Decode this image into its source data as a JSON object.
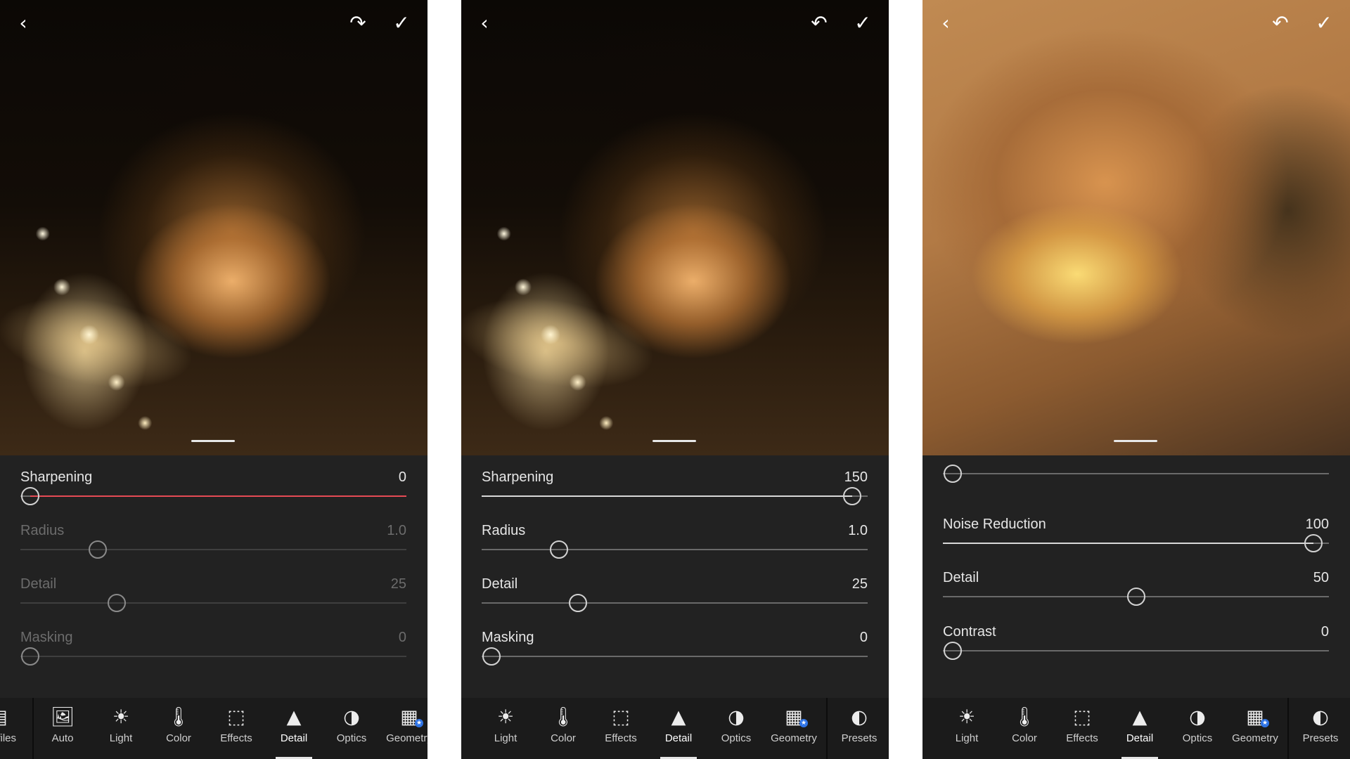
{
  "colors": {
    "accent_red": "#e64b55",
    "badge_blue": "#2f74e6",
    "panel_bg": "#232323"
  },
  "panels": [
    {
      "top_icons": [
        "back-icon",
        "redo-icon",
        "check-icon"
      ],
      "sliders": [
        {
          "label": "Sharpening",
          "value": "0",
          "level": 0,
          "active": true,
          "red": true
        },
        {
          "label": "Radius",
          "value": "1.0",
          "level": 0.2,
          "active": false
        },
        {
          "label": "Detail",
          "value": "25",
          "level": 0.25,
          "active": false
        },
        {
          "label": "Masking",
          "value": "0",
          "level": 0,
          "active": false
        }
      ],
      "tools": [
        {
          "label": "Profiles",
          "icon": "profiles-icon"
        },
        {
          "label": "Auto",
          "icon": "auto-icon"
        },
        {
          "label": "Light",
          "icon": "light-icon"
        },
        {
          "label": "Color",
          "icon": "color-icon"
        },
        {
          "label": "Effects",
          "icon": "effects-icon"
        },
        {
          "label": "Detail",
          "icon": "detail-icon",
          "active": true
        },
        {
          "label": "Optics",
          "icon": "optics-icon"
        },
        {
          "label": "Geometry",
          "icon": "geometry-icon"
        }
      ]
    },
    {
      "top_icons": [
        "back-icon",
        "undo-icon",
        "check-icon"
      ],
      "sliders": [
        {
          "label": "Sharpening",
          "value": "150",
          "level": 1,
          "active": true
        },
        {
          "label": "Radius",
          "value": "1.0",
          "level": 0.2,
          "active": true
        },
        {
          "label": "Detail",
          "value": "25",
          "level": 0.25,
          "active": true
        },
        {
          "label": "Masking",
          "value": "0",
          "level": 0,
          "active": true
        }
      ],
      "tools": [
        {
          "label": "Light",
          "icon": "light-icon"
        },
        {
          "label": "Color",
          "icon": "color-icon"
        },
        {
          "label": "Effects",
          "icon": "effects-icon"
        },
        {
          "label": "Detail",
          "icon": "detail-icon",
          "active": true
        },
        {
          "label": "Optics",
          "icon": "optics-icon"
        },
        {
          "label": "Geometry",
          "icon": "geometry-icon"
        },
        {
          "label": "Presets",
          "icon": "presets-icon"
        }
      ]
    },
    {
      "top_icons": [
        "back-icon",
        "undo-icon",
        "check-icon"
      ],
      "sliders": [
        {
          "label": "",
          "value": "",
          "level": 0,
          "active": true
        },
        {
          "label": "Noise Reduction",
          "value": "100",
          "level": 1,
          "active": true
        },
        {
          "label": "Detail",
          "value": "50",
          "level": 0.5,
          "active": true
        },
        {
          "label": "Contrast",
          "value": "0",
          "level": 0,
          "active": true
        }
      ],
      "tools": [
        {
          "label": "Light",
          "icon": "light-icon"
        },
        {
          "label": "Color",
          "icon": "color-icon"
        },
        {
          "label": "Effects",
          "icon": "effects-icon"
        },
        {
          "label": "Detail",
          "icon": "detail-icon",
          "active": true
        },
        {
          "label": "Optics",
          "icon": "optics-icon"
        },
        {
          "label": "Geometry",
          "icon": "geometry-icon"
        },
        {
          "label": "Presets",
          "icon": "presets-icon"
        }
      ]
    }
  ]
}
